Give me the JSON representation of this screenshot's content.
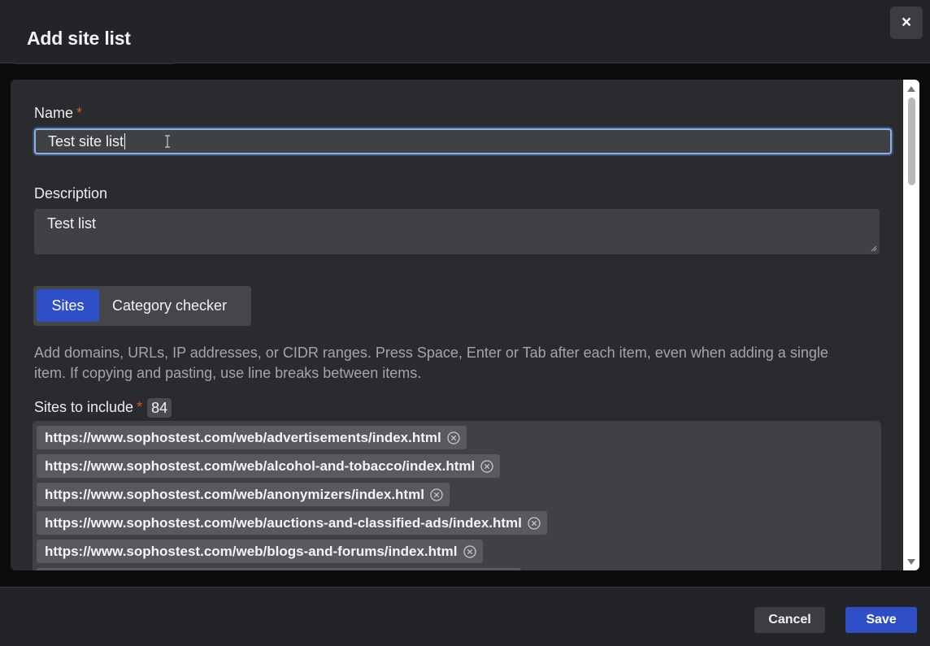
{
  "dialog": {
    "title": "Add site list",
    "close_label": "×"
  },
  "form": {
    "name_label": "Name",
    "name_value": "Test site list",
    "description_label": "Description",
    "description_value": "Test list",
    "required_mark": "*"
  },
  "tabs": [
    {
      "label": "Sites",
      "active": true
    },
    {
      "label": "Category checker",
      "active": false
    }
  ],
  "help_text": "Add domains, URLs, IP addresses, or CIDR ranges. Press Space, Enter or Tab after each item, even when adding a single item. If copying and pasting, use line breaks between items.",
  "sites": {
    "label": "Sites to include",
    "count": "84",
    "items": [
      "https://www.sophostest.com/web/advertisements/index.html",
      "https://www.sophostest.com/web/alcohol-and-tobacco/index.html",
      "https://www.sophostest.com/web/anonymizers/index.html",
      "https://www.sophostest.com/web/auctions-and-classified-ads/index.html",
      "https://www.sophostest.com/web/blogs-and-forums/index.html"
    ]
  },
  "footer": {
    "cancel_label": "Cancel",
    "save_label": "Save"
  },
  "colors": {
    "accent": "#2f4fc7",
    "required": "#e3542b",
    "focus_ring": "#8fb3e8"
  },
  "icons": {
    "close": "close-icon",
    "chip_remove": "remove-circle-icon",
    "cursor": "text-cursor-icon"
  }
}
